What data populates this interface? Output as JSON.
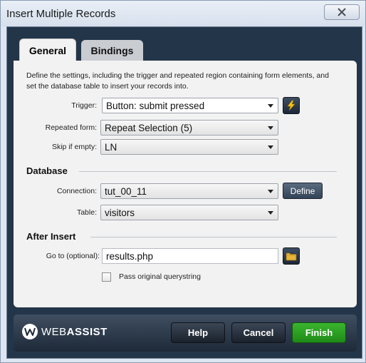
{
  "window": {
    "title": "Insert Multiple Records"
  },
  "tabs": [
    {
      "label": "General"
    },
    {
      "label": "Bindings"
    }
  ],
  "description": "Define the settings, including the trigger and repeated region containing form elements, and set the database table to insert your records into.",
  "general": {
    "trigger": {
      "label": "Trigger:",
      "value": "Button: submit pressed"
    },
    "repeated_form": {
      "label": "Repeated form:",
      "value": "Repeat Selection (5)"
    },
    "skip_if_empty": {
      "label": "Skip if empty:",
      "value": "LN"
    }
  },
  "database": {
    "heading": "Database",
    "connection": {
      "label": "Connection:",
      "value": "tut_00_11"
    },
    "define_label": "Define",
    "table": {
      "label": "Table:",
      "value": "visitors"
    }
  },
  "after_insert": {
    "heading": "After Insert",
    "goto": {
      "label": "Go to (optional):",
      "value": "results.php"
    },
    "pass_querystring": {
      "label": "Pass original querystring",
      "checked": false
    }
  },
  "footer": {
    "brand": {
      "part1": "WEB",
      "part2": "ASSIST"
    },
    "help_label": "Help",
    "cancel_label": "Cancel",
    "finish_label": "Finish"
  },
  "colors": {
    "accent": "#2a9b20",
    "frame": "#233549",
    "bolt": "#f5c518"
  },
  "icons": [
    "close-icon",
    "lightning-icon",
    "folder-icon",
    "webassist-logo-icon",
    "chevron-down-icon"
  ]
}
